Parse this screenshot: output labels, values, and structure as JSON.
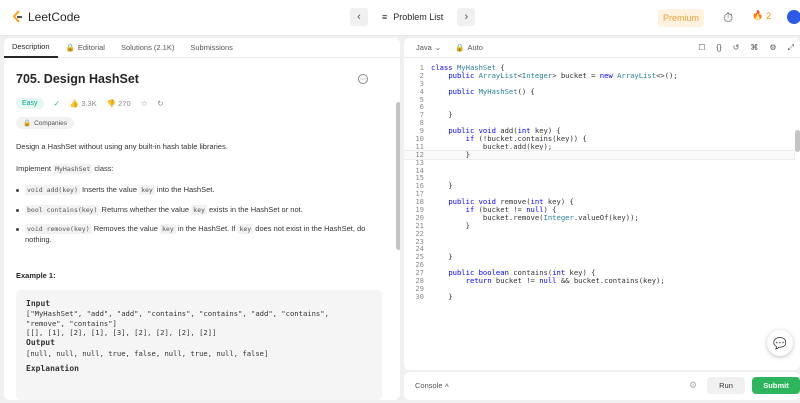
{
  "topbar": {
    "logo_text": "LeetCode",
    "problem_list_label": "Problem List",
    "premium_label": "Premium",
    "streak_count": "2",
    "icons": [
      "leetcode-logo-icon",
      "chevron-left-icon",
      "list-icon",
      "chevron-right-icon",
      "timer-icon",
      "fire-icon",
      "avatar-icon"
    ]
  },
  "left": {
    "tabs": [
      {
        "label": "Description"
      },
      {
        "label": "Editorial"
      },
      {
        "label": "Solutions (2.1K)"
      },
      {
        "label": "Submissions"
      }
    ],
    "title": "705. Design HashSet",
    "difficulty": "Easy",
    "likes": "3.3K",
    "dislikes": "270",
    "companies_label": "Companies",
    "intro": "Design a HashSet without using any built-in hash table libraries.",
    "implement_prefix": "Implement ",
    "implement_code": "MyHashSet",
    "implement_suffix": " class:",
    "bullets": [
      {
        "code": "void add(key)",
        "text_a": " Inserts the value ",
        "code2": "key",
        "text_b": " into the HashSet."
      },
      {
        "code": "bool contains(key)",
        "text_a": " Returns whether the value ",
        "code2": "key",
        "text_b": " exists in the HashSet or not."
      },
      {
        "code": "void remove(key)",
        "text_a": " Removes the value ",
        "code2": "key",
        "text_b": " in the HashSet. If ",
        "code3": "key",
        "text_c": " does not exist in the HashSet, do nothing."
      }
    ],
    "example_title": "Example 1:",
    "example": {
      "input_label": "Input",
      "input_line1": "[\"MyHashSet\", \"add\", \"add\", \"contains\", \"contains\", \"add\", \"contains\",",
      "input_line2": "\"remove\", \"contains\"]",
      "input_line3": "[[], [1], [2], [1], [3], [2], [2], [2], [2]]",
      "output_label": "Output",
      "output_line": "[null, null, null, true, false, null, true, null, false]",
      "explanation_label": "Explanation"
    }
  },
  "editor": {
    "language": "Java",
    "auto_label": "Auto",
    "lines": [
      "class MyHashSet {",
      "    public ArrayList<Integer> bucket = new ArrayList<>();",
      "",
      "    public MyHashSet() {",
      "",
      "",
      "    }",
      "",
      "    public void add(int key) {",
      "        if (!bucket.contains(key)) {",
      "            bucket.add(key);",
      "        }",
      "",
      "",
      "",
      "    }",
      "",
      "    public void remove(int key) {",
      "        if (bucket != null) {",
      "            bucket.remove(Integer.valueOf(key));",
      "        }",
      "",
      "",
      "",
      "    }",
      "",
      "    public boolean contains(int key) {",
      "        return bucket != null && bucket.contains(key);",
      "",
      "    }"
    ],
    "line_numbers": [
      "1",
      "2",
      "3",
      "4",
      "5",
      "6",
      "7",
      "8",
      "9",
      "10",
      "11",
      "12",
      "13",
      "14",
      "15",
      "16",
      "17",
      "18",
      "19",
      "20",
      "21",
      "22",
      "23",
      "24",
      "25",
      "26",
      "27",
      "28",
      "29",
      "30"
    ],
    "current_line": 12
  },
  "console": {
    "label": "Console",
    "run_label": "Run",
    "submit_label": "Submit"
  },
  "colors": {
    "easy": "#00a88f",
    "submit": "#2db55d",
    "premium": "#e8a13a",
    "streak": "#ff8a00"
  }
}
